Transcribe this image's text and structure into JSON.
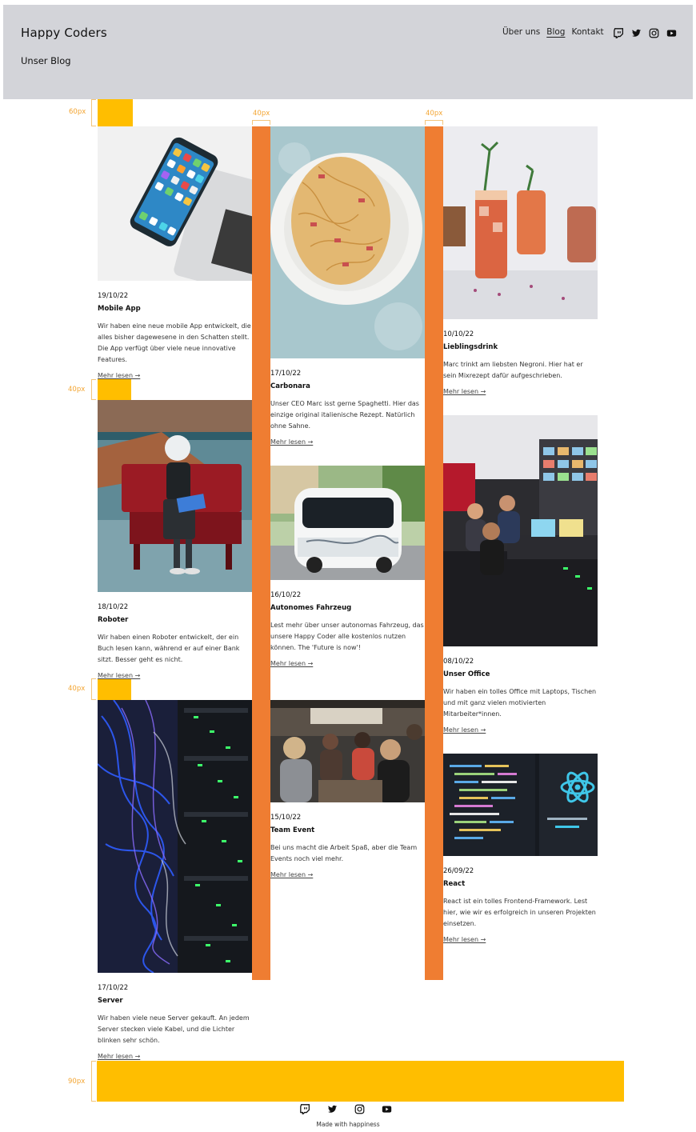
{
  "header": {
    "logo": "Happy Coders",
    "subtitle": "Unser Blog",
    "nav": [
      "Über uns",
      "Blog",
      "Kontakt"
    ],
    "social_icons": [
      "twitch-icon",
      "twitter-icon",
      "instagram-icon",
      "youtube-icon"
    ]
  },
  "annotations": {
    "top_spacer": "60px",
    "gutter_1": "40px",
    "gutter_2": "40px",
    "row_gap_1": "40px",
    "row_gap_2": "40px",
    "bottom_spacer": "90px"
  },
  "colors": {
    "header_bg": "#d3d4d9",
    "spacer": "#ffbe00",
    "gutter": "#ef7d32"
  },
  "posts": [
    {
      "date": "19/10/22",
      "title": "Mobile App",
      "text": "Wir haben eine neue mobile App entwickelt, die alles bisher dagewesene in den Schatten stellt. Die App verfügt über viele neue innovative Features.",
      "more": "Mehr lesen →"
    },
    {
      "date": "18/10/22",
      "title": "Roboter",
      "text": "Wir haben einen Roboter entwickelt, der ein Buch lesen kann, während er auf einer Bank sitzt. Besser geht es nicht.",
      "more": "Mehr lesen →"
    },
    {
      "date": "17/10/22",
      "title": "Server",
      "text": "Wir haben viele neue Server gekauft. An jedem Server stecken viele Kabel, und die Lichter blinken sehr schön.",
      "more": "Mehr lesen →"
    },
    {
      "date": "17/10/22",
      "title": "Carbonara",
      "text": "Unser CEO Marc isst gerne Spaghetti. Hier das einzige original italienische Rezept. Natürlich ohne Sahne.",
      "more": "Mehr lesen →"
    },
    {
      "date": "16/10/22",
      "title": "Autonomes Fahrzeug",
      "text": "Lest mehr über unser autonomas Fahrzeug, das unsere Happy Coder alle kostenlos nutzen können. The 'Future is now'!",
      "more": "Mehr lesen →"
    },
    {
      "date": "15/10/22",
      "title": "Team Event",
      "text": "Bei uns macht die Arbeit Spaß, aber die Team Events noch viel mehr.",
      "more": "Mehr lesen →"
    },
    {
      "date": "10/10/22",
      "title": "Lieblingsdrink",
      "text": "Marc trinkt am liebsten Negroni. Hier hat er sein Mixrezept dafür aufgeschrieben.",
      "more": "Mehr lesen →"
    },
    {
      "date": "08/10/22",
      "title": "Unser Office",
      "text": "Wir haben ein tolles Office mit Laptops, Tischen und mit ganz vielen motivierten Mitarbeiter*innen.",
      "more": "Mehr lesen →"
    },
    {
      "date": "26/09/22",
      "title": "React",
      "text": "React ist ein tolles Frontend-Framework. Lest hier, wie wir es erfolgreich in unseren Projekten einsetzen.",
      "more": "Mehr lesen →"
    }
  ],
  "footer": {
    "icons": [
      "twitch-icon",
      "twitter-icon",
      "instagram-icon",
      "youtube-icon"
    ],
    "text": "Made with happiness"
  }
}
